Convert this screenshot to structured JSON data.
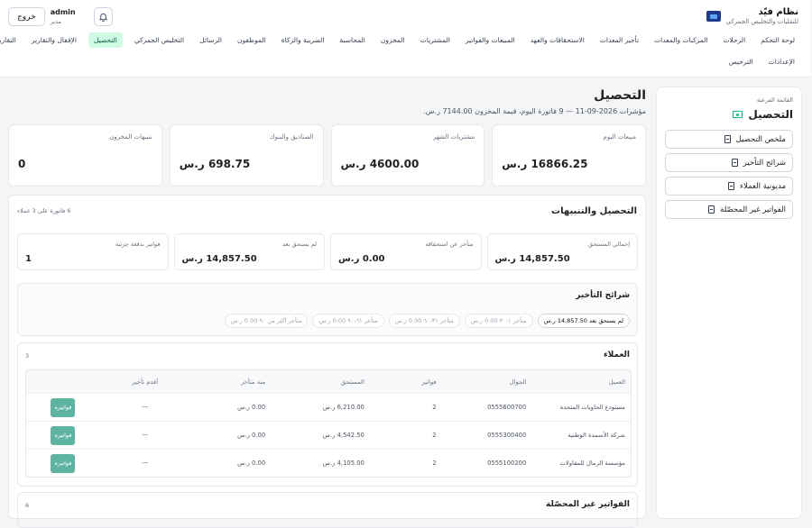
{
  "brand": {
    "name": "نظام فيّد",
    "subtitle": "للنقليات والتخليص الجمركي"
  },
  "user": {
    "name": "admin",
    "role": "مدير",
    "logout_label": "خروج"
  },
  "nav": {
    "row1": [
      "لوحة التحكم",
      "الرحلات",
      "المركبات والمعدات",
      "تأجير المعدات",
      "الاستحقاقات والعهد",
      "المبيعات والفواتير",
      "المشتريات",
      "المخزون",
      "المحاسبة",
      "الضريبة والزكاة",
      "الموظفون",
      "الرسائل",
      "التخليص الجمركي",
      "التحصيل",
      "الإقفال والتقارير",
      "التقارير"
    ],
    "row2": [
      "الإعدادات",
      "الترخيص"
    ],
    "active_index": 13
  },
  "sidebar": {
    "caption": "القائمة الفرعية",
    "title": "التحصيل",
    "items": [
      "ملخص التحصيل",
      "شرائح التأخير",
      "مديونية العملاء",
      "الفواتير غير المحصّلة"
    ]
  },
  "page": {
    "title": "التحصيل",
    "subtitle": "مؤشرات 2026-09-11 — 9 فاتورة اليوم، قيمة المخزون 7144.00 ر.س."
  },
  "stats": [
    {
      "label": "مبيعات اليوم",
      "value": "16866.25 ر.س"
    },
    {
      "label": "مشتريات الشهر",
      "value": "4600.00 ر.س"
    },
    {
      "label": "الصناديق والبنوك",
      "value": "698.75 ر.س"
    },
    {
      "label": "تنبيهات المخزون",
      "value": "0"
    }
  ],
  "collection": {
    "title": "التحصيل والتنبيهات",
    "note": "6 فاتورة على 3 عملاء",
    "summary": [
      {
        "label": "إجمالي المستحق",
        "value": "14,857.50 ر.س"
      },
      {
        "label": "متأخر عن استحقاقه",
        "value": "0.00 ر.س"
      },
      {
        "label": "لم يستحق بعد",
        "value": "14,857.50 ر.س"
      },
      {
        "label": "فواتير بدفعة جزئية",
        "value": "1"
      }
    ],
    "aging": {
      "title": "شرائح التأخير",
      "chips": [
        "لم يستحق بعد 14,857.50 ر.س",
        "متأخر ١-٣٠ 0.00 ر.س",
        "متأخر ٣١-٦٠ 0.00 ر.س",
        "متأخر ٦١-٩٠ 0.00 ر.س",
        "متأخر أكثر من ٩٠ 0.00 ر.س"
      ]
    },
    "customers": {
      "title": "العملاء",
      "count": "3",
      "headers": [
        "العميل",
        "الجوال",
        "فواتير",
        "المستحق",
        "منه متأخر",
        "أقدم تأخير"
      ],
      "rows": [
        {
          "name": "مستودع الحاويات المتحدة",
          "phone": "0555600700",
          "invoices": "2",
          "due": "6,210.00 ر.س",
          "overdue": "0.00 ر.س",
          "oldest": "—",
          "action": "فواتيره"
        },
        {
          "name": "شركة الأسمدة الوطنية",
          "phone": "0555300400",
          "invoices": "2",
          "due": "4,542.50 ر.س",
          "overdue": "0.00 ر.س",
          "oldest": "—",
          "action": "فواتيره"
        },
        {
          "name": "مؤسسة الرمال للمقاولات",
          "phone": "0555100200",
          "invoices": "2",
          "due": "4,105.00 ر.س",
          "overdue": "0.00 ر.س",
          "oldest": "—",
          "action": "فواتيره"
        }
      ]
    },
    "open_invoices": {
      "title": "الفواتير غير المحصّلة",
      "count": "6"
    }
  }
}
